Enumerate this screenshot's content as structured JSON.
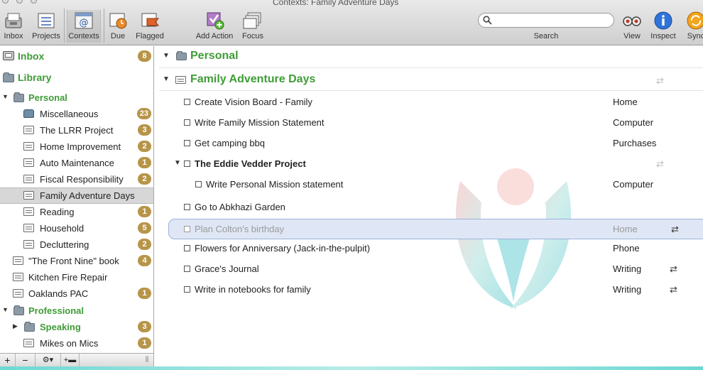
{
  "window": {
    "title": "Contexts: Family Adventure Days"
  },
  "toolbar": {
    "inbox": "Inbox",
    "projects": "Projects",
    "contexts": "Contexts",
    "due": "Due",
    "flagged": "Flagged",
    "add_action": "Add Action",
    "focus": "Focus",
    "search_label": "Search",
    "search_placeholder": "",
    "view": "View",
    "inspect": "Inspect",
    "sync": "Sync"
  },
  "sidebar": {
    "inbox": {
      "label": "Inbox",
      "count": "8"
    },
    "library": {
      "label": "Library"
    },
    "items": [
      {
        "label": "Personal",
        "count": ""
      },
      {
        "label": "Miscellaneous",
        "count": "23"
      },
      {
        "label": "The LLRR Project",
        "count": "3"
      },
      {
        "label": "Home Improvement",
        "count": "2"
      },
      {
        "label": "Auto Maintenance",
        "count": "1"
      },
      {
        "label": "Fiscal Responsibility",
        "count": "2"
      },
      {
        "label": "Family Adventure Days",
        "count": ""
      },
      {
        "label": "Reading",
        "count": "1"
      },
      {
        "label": "Household",
        "count": "5"
      },
      {
        "label": "Decluttering",
        "count": "2"
      },
      {
        "label": "\"The Front Nine\" book",
        "count": "4"
      },
      {
        "label": "Kitchen Fire Repair",
        "count": ""
      },
      {
        "label": "Oaklands PAC",
        "count": "1"
      },
      {
        "label": "Professional",
        "count": ""
      },
      {
        "label": "Speaking",
        "count": "3"
      },
      {
        "label": "Mikes on Mics",
        "count": "1"
      }
    ],
    "footer": {
      "add": "+",
      "remove": "−",
      "gear": "⚙▾",
      "add_folder": "+▬",
      "grip": "⦀"
    }
  },
  "main": {
    "folder_title": "Personal",
    "project_title": "Family Adventure Days",
    "actions": [
      {
        "text": "Create Vision Board - Family",
        "context": "Home"
      },
      {
        "text": "Write Family Mission Statement",
        "context": "Computer"
      },
      {
        "text": "Get camping bbq",
        "context": "Purchases"
      },
      {
        "text": "The Eddie Vedder Project",
        "context": ""
      },
      {
        "text": "Write Personal Mission statement",
        "context": "Computer"
      },
      {
        "text": "Go to Abkhazi Garden",
        "context": ""
      },
      {
        "text": "Plan Colton's birthday",
        "context": "Home"
      },
      {
        "text": "Flowers for Anniversary (Jack-in-the-pulpit)",
        "context": "Phone"
      },
      {
        "text": "Grace's Journal",
        "context": "Writing"
      },
      {
        "text": "Write in notebooks for family",
        "context": "Writing"
      }
    ],
    "glyphs": {
      "repeat": "⇄",
      "expanded": "▼",
      "collapsed": "▶"
    }
  },
  "colors": {
    "accent_green": "#3e9c36",
    "badge_gold": "#b79548",
    "selection_blue": "#dfe7f6"
  }
}
